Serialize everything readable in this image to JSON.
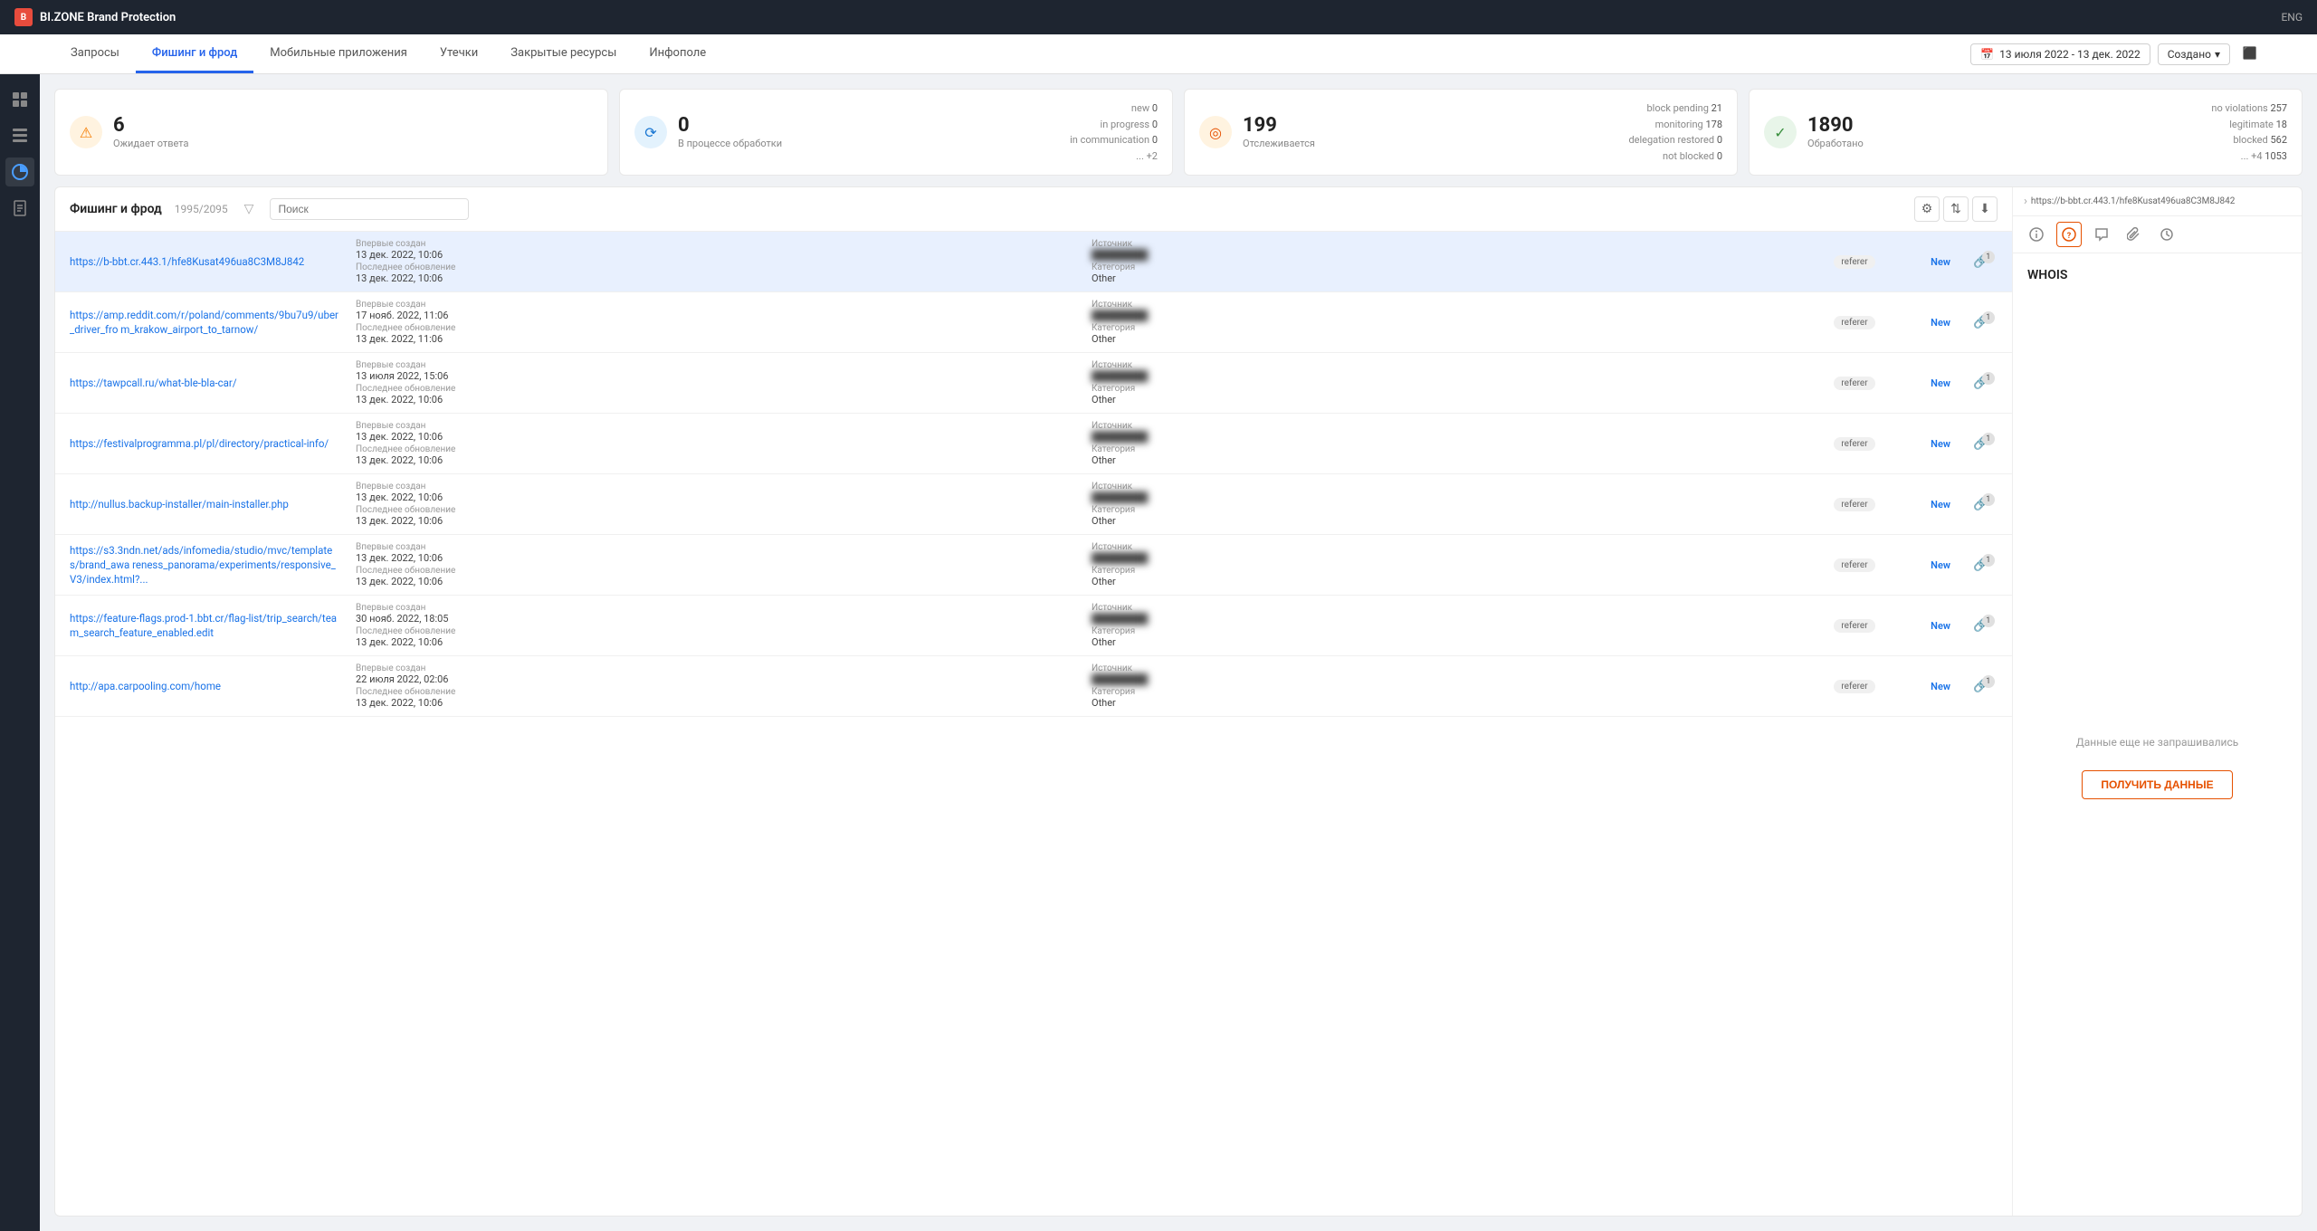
{
  "topbar": {
    "brand": "BI.ZONE Brand Protection",
    "lang": "ENG"
  },
  "nav": {
    "tabs": [
      {
        "id": "requests",
        "label": "Запросы"
      },
      {
        "id": "phishing",
        "label": "Фишинг и фрод",
        "active": true
      },
      {
        "id": "mobile",
        "label": "Мобильные приложения"
      },
      {
        "id": "leaks",
        "label": "Утечки"
      },
      {
        "id": "closed",
        "label": "Закрытые ресурсы"
      },
      {
        "id": "infopole",
        "label": "Инфополе"
      }
    ],
    "date_filter": "13 июля 2022 - 13 дек. 2022",
    "sort_label": "Создано"
  },
  "sidebar": {
    "icons": [
      {
        "id": "dashboard",
        "symbol": "⊞"
      },
      {
        "id": "table",
        "symbol": "▦"
      },
      {
        "id": "chart",
        "symbol": "◈",
        "active": true
      },
      {
        "id": "doc",
        "symbol": "☰"
      }
    ]
  },
  "stats": [
    {
      "id": "awaiting",
      "icon_type": "warning",
      "icon_symbol": "⚠",
      "number": "6",
      "label": "Ожидает ответа",
      "details": []
    },
    {
      "id": "processing",
      "icon_type": "blue",
      "icon_symbol": "⟳",
      "number": "0",
      "label": "В процессе обработки",
      "details": [
        {
          "label": "new",
          "value": "0"
        },
        {
          "label": "in progress",
          "value": "0"
        },
        {
          "label": "in communication",
          "value": "0"
        },
        {
          "label": "... +2",
          "value": ""
        }
      ]
    },
    {
      "id": "monitoring",
      "icon_type": "orange",
      "icon_symbol": "◎",
      "number": "199",
      "label": "Отслеживается",
      "details": [
        {
          "label": "block pending",
          "value": "21"
        },
        {
          "label": "monitoring",
          "value": "178"
        },
        {
          "label": "delegation restored",
          "value": "0"
        },
        {
          "label": "not blocked",
          "value": "0"
        }
      ]
    },
    {
      "id": "processed",
      "icon_type": "green",
      "icon_symbol": "✓",
      "number": "1890",
      "label": "Обработано",
      "details": [
        {
          "label": "no violations",
          "value": "257"
        },
        {
          "label": "legitimate",
          "value": "18"
        },
        {
          "label": "blocked",
          "value": "562"
        },
        {
          "label": "... +4",
          "value": "1053"
        }
      ]
    }
  ],
  "list": {
    "title": "Фишинг и фрод",
    "count": "1995/2095",
    "search_placeholder": "Поиск",
    "rows": [
      {
        "url": "https://b-bbt.cr.443.1/hfe8Kusat496ua8C3M8J842",
        "first_created_label": "Впервые создан",
        "first_created": "13 дек. 2022, 10:06",
        "source_label": "Источник",
        "source": "██████████",
        "last_updated_label": "Последнее обновление",
        "last_updated": "13 дек. 2022, 10:06",
        "category_label": "Категория",
        "category": "Other",
        "tag": "referer",
        "status": "New",
        "link_count": "1",
        "selected": true
      },
      {
        "url": "https://amp.reddit.com/r/poland/comments/9bu7u9/uber_driver_fro m_krakow_airport_to_tarnow/",
        "first_created_label": "Впервые создан",
        "first_created": "17 нояб. 2022, 11:06",
        "source_label": "Источник",
        "source": "██████████",
        "last_updated_label": "Последнее обновление",
        "last_updated": "13 дек. 2022, 11:06",
        "category_label": "Категория",
        "category": "Other",
        "tag": "referer",
        "status": "New",
        "link_count": "1",
        "selected": false
      },
      {
        "url": "https://tawpcall.ru/what-ble-bla-car/",
        "first_created_label": "Впервые создан",
        "first_created": "13 июля 2022, 15:06",
        "source_label": "Источник",
        "source": "██████████",
        "last_updated_label": "Последнее обновление",
        "last_updated": "13 дек. 2022, 10:06",
        "category_label": "Категория",
        "category": "Other",
        "tag": "referer",
        "status": "New",
        "link_count": "1",
        "selected": false
      },
      {
        "url": "https://festivalprogramma.pl/pl/directory/practical-info/",
        "first_created_label": "Впервые создан",
        "first_created": "13 дек. 2022, 10:06",
        "source_label": "Источник",
        "source": "██████████",
        "last_updated_label": "Последнее обновление",
        "last_updated": "13 дек. 2022, 10:06",
        "category_label": "Категория",
        "category": "Other",
        "tag": "referer",
        "status": "New",
        "link_count": "1",
        "selected": false
      },
      {
        "url": "http://nullus.backup-installer/main-installer.php",
        "first_created_label": "Впервые создан",
        "first_created": "13 дек. 2022, 10:06",
        "source_label": "Источник",
        "source": "██████████",
        "last_updated_label": "Последнее обновление",
        "last_updated": "13 дек. 2022, 10:06",
        "category_label": "Категория",
        "category": "Other",
        "tag": "referer",
        "status": "New",
        "link_count": "1",
        "selected": false
      },
      {
        "url": "https://s3.3ndn.net/ads/infomedia/studio/mvc/templates/brand_awa reness_panorama/experiments/responsive_V3/index.html?...",
        "first_created_label": "Впервые создан",
        "first_created": "13 дек. 2022, 10:06",
        "source_label": "Источник",
        "source": "██████████",
        "last_updated_label": "Последнее обновление",
        "last_updated": "13 дек. 2022, 10:06",
        "category_label": "Категория",
        "category": "Other",
        "tag": "referer",
        "status": "New",
        "link_count": "1",
        "selected": false
      },
      {
        "url": "https://feature-flags.prod-1.bbt.cr/flag-list/trip_search/team_search_feature_enabled.edit",
        "first_created_label": "Впервые создан",
        "first_created": "30 нояб. 2022, 18:05",
        "source_label": "Источник",
        "source": "██████████",
        "last_updated_label": "Последнее обновление",
        "last_updated": "13 дек. 2022, 10:06",
        "category_label": "Категория",
        "category": "Other",
        "tag": "referer",
        "status": "New",
        "link_count": "1",
        "selected": false
      },
      {
        "url": "http://apa.carpooling.com/home",
        "first_created_label": "Впервые создан",
        "first_created": "22 июля 2022, 02:06",
        "source_label": "Источник",
        "source": "██████████",
        "last_updated_label": "Последнее обновление",
        "last_updated": "13 дек. 2022, 10:06",
        "category_label": "Категория",
        "category": "Other",
        "tag": "referer",
        "status": "New",
        "link_count": "1",
        "selected": false
      }
    ]
  },
  "detail": {
    "url": "https://b-bbt.cr.443.1/hfe8Kusat496ua8C3M8J842",
    "section": "WHOIS",
    "no_data_text": "Данные еще не запрашивались",
    "get_data_btn": "ПОЛУЧИТЬ ДАННЫЕ",
    "tabs": [
      {
        "id": "info",
        "symbol": "ℹ",
        "active": false
      },
      {
        "id": "whois",
        "symbol": "?",
        "active": true
      },
      {
        "id": "comment",
        "symbol": "💬",
        "active": false
      },
      {
        "id": "attach",
        "symbol": "📎",
        "active": false
      },
      {
        "id": "history",
        "symbol": "🕐",
        "active": false
      }
    ]
  }
}
